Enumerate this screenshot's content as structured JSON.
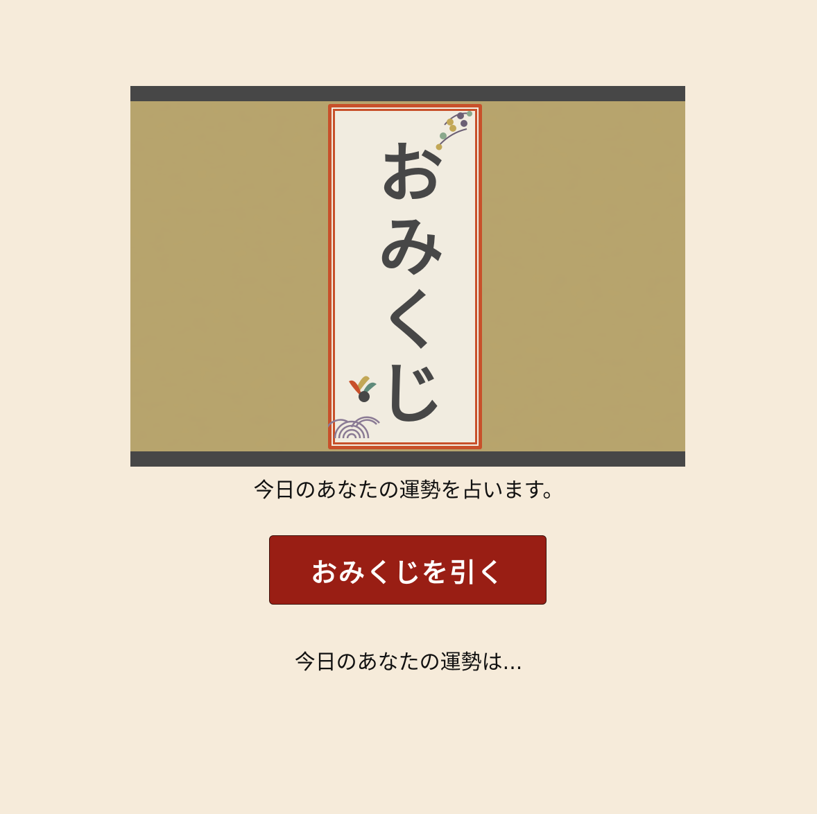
{
  "banner": {
    "title": "おみくじ",
    "colors": {
      "frame": "#474747",
      "background": "#b8a46c",
      "card_border": "#c8502a",
      "card_paper": "#f1ece0",
      "title_text": "#474747"
    },
    "decorations": [
      "beads-icon",
      "leaf-sprig-icon",
      "wave-pattern-icon"
    ]
  },
  "main": {
    "description": "今日のあなたの運勢を占います。",
    "draw_button_label": "おみくじを引く",
    "result_text": "今日のあなたの運勢は..."
  },
  "theme": {
    "page_background": "#f6ebda",
    "button_background": "#991e14",
    "button_text": "#ffffff",
    "text": "#111111"
  }
}
